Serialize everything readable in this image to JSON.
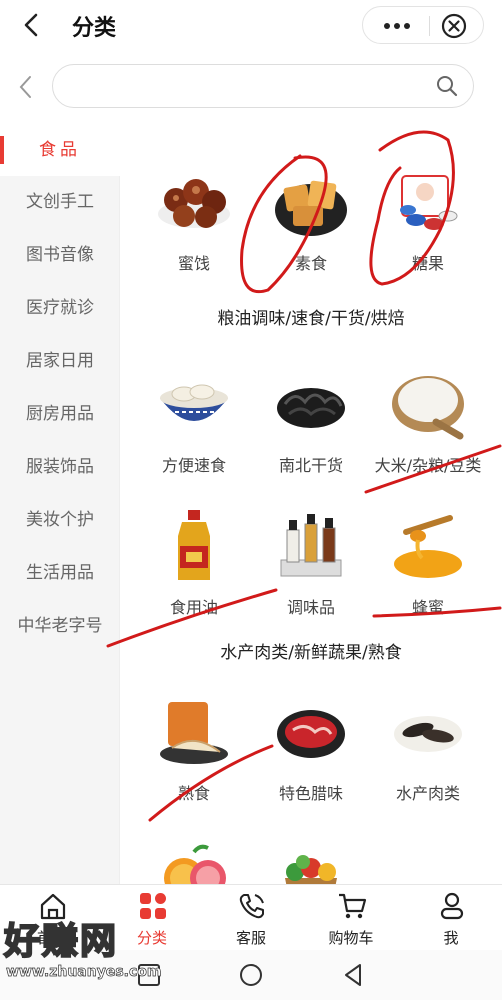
{
  "header": {
    "title": "分类"
  },
  "search": {
    "placeholder": ""
  },
  "sidebar": {
    "items": [
      {
        "label": "食品",
        "active": true
      },
      {
        "label": "文创手工"
      },
      {
        "label": "图书音像"
      },
      {
        "label": "医疗就诊"
      },
      {
        "label": "居家日用"
      },
      {
        "label": "厨房用品"
      },
      {
        "label": "服装饰品"
      },
      {
        "label": "美妆个护"
      },
      {
        "label": "生活用品"
      },
      {
        "label": "中华老字号"
      }
    ]
  },
  "content": {
    "top_items": [
      {
        "label": "蜜饯",
        "icon": "candied-mushroom-image"
      },
      {
        "label": "素食",
        "icon": "tofu-snack-image"
      },
      {
        "label": "糖果",
        "icon": "candy-image"
      }
    ],
    "sections": [
      {
        "title": "粮油调味/速食/干货/烘焙",
        "items": [
          {
            "label": "方便速食",
            "icon": "dumplings-image"
          },
          {
            "label": "南北干货",
            "icon": "dried-fungus-image"
          },
          {
            "label": "大米/杂粮/豆类",
            "icon": "rice-image"
          },
          {
            "label": "食用油",
            "icon": "oil-bottle-image"
          },
          {
            "label": "调味品",
            "icon": "seasoning-bottles-image"
          },
          {
            "label": "蜂蜜",
            "icon": "honey-image"
          }
        ]
      },
      {
        "title": "水产肉类/新鲜蔬果/熟食",
        "items": [
          {
            "label": "熟食",
            "icon": "cooked-meat-image"
          },
          {
            "label": "特色腊味",
            "icon": "cured-meat-image"
          },
          {
            "label": "水产肉类",
            "icon": "sea-cucumber-image"
          },
          {
            "label": "",
            "icon": "citrus-fruit-image"
          },
          {
            "label": "",
            "icon": "vegetable-basket-image"
          }
        ]
      }
    ]
  },
  "tabbar": {
    "items": [
      {
        "label": "首页",
        "icon": "home-icon"
      },
      {
        "label": "分类",
        "icon": "category-icon",
        "active": true
      },
      {
        "label": "客服",
        "icon": "phone-icon"
      },
      {
        "label": "购物车",
        "icon": "cart-icon"
      },
      {
        "label": "我",
        "icon": "user-icon"
      }
    ]
  },
  "watermark": {
    "text": "好赚网",
    "url": "www.zhuanyes.com"
  },
  "colors": {
    "accent": "#e83b33",
    "sidebar_bg": "#f5f5f5",
    "text": "#333333"
  }
}
